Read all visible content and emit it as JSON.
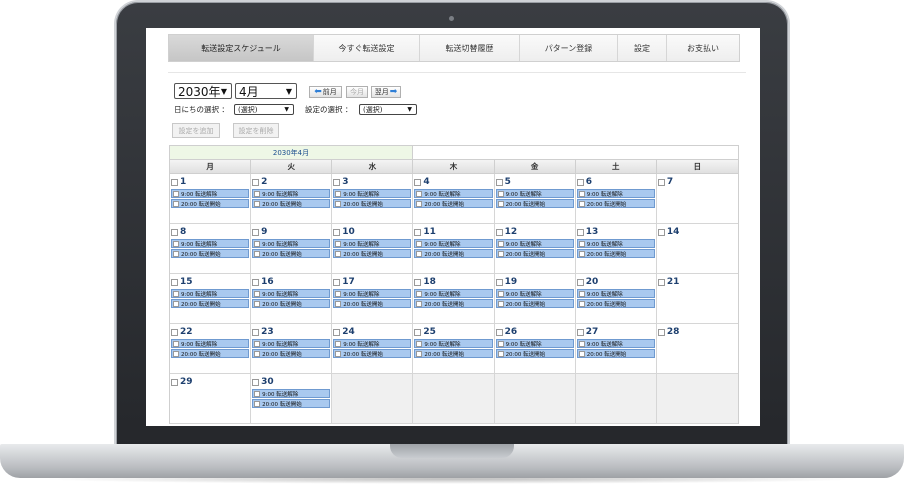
{
  "tabs": [
    {
      "label": "転送設定スケジュール",
      "active": true
    },
    {
      "label": "今すぐ転送設定",
      "active": false
    },
    {
      "label": "転送切替履歴",
      "active": false
    },
    {
      "label": "パターン登録",
      "active": false
    },
    {
      "label": "設定",
      "active": false
    },
    {
      "label": "お支払い",
      "active": false
    }
  ],
  "controls": {
    "year_value": "2030年",
    "month_value": "4月",
    "prev_label": "前月",
    "today_label": "今月",
    "next_label": "翌月",
    "day_select_label": "日にちの選択 ：",
    "day_select_value": "(選択)",
    "setting_select_label": "設定の選択 ：",
    "setting_select_value": "(選択)",
    "add_button": "設定を追加",
    "delete_button": "設定を削除"
  },
  "calendar": {
    "month_title": "2030年4月",
    "weekdays": [
      "月",
      "火",
      "水",
      "木",
      "金",
      "土",
      "日"
    ],
    "event_color": "#a9c9ef",
    "weeks": [
      [
        {
          "day": "1",
          "events": [
            "9:00 転送解除",
            "20:00 転送開始"
          ]
        },
        {
          "day": "2",
          "events": [
            "9:00 転送解除",
            "20:00 転送開始"
          ]
        },
        {
          "day": "3",
          "events": [
            "9:00 転送解除",
            "20:00 転送開始"
          ]
        },
        {
          "day": "4",
          "events": [
            "9:00 転送解除",
            "20:00 転送開始"
          ]
        },
        {
          "day": "5",
          "events": [
            "9:00 転送解除",
            "20:00 転送開始"
          ]
        },
        {
          "day": "6",
          "events": [
            "9:00 転送解除",
            "20:00 転送開始"
          ]
        },
        {
          "day": "7",
          "events": []
        }
      ],
      [
        {
          "day": "8",
          "events": [
            "9:00 転送解除",
            "20:00 転送開始"
          ]
        },
        {
          "day": "9",
          "events": [
            "9:00 転送解除",
            "20:00 転送開始"
          ]
        },
        {
          "day": "10",
          "events": [
            "9:00 転送解除",
            "20:00 転送開始"
          ]
        },
        {
          "day": "11",
          "events": [
            "9:00 転送解除",
            "20:00 転送開始"
          ]
        },
        {
          "day": "12",
          "events": [
            "9:00 転送解除",
            "20:00 転送開始"
          ]
        },
        {
          "day": "13",
          "events": [
            "9:00 転送解除",
            "20:00 転送開始"
          ]
        },
        {
          "day": "14",
          "events": []
        }
      ],
      [
        {
          "day": "15",
          "events": [
            "9:00 転送解除",
            "20:00 転送開始"
          ]
        },
        {
          "day": "16",
          "events": [
            "9:00 転送解除",
            "20:00 転送開始"
          ]
        },
        {
          "day": "17",
          "events": [
            "9:00 転送解除",
            "20:00 転送開始"
          ]
        },
        {
          "day": "18",
          "events": [
            "9:00 転送解除",
            "20:00 転送開始"
          ]
        },
        {
          "day": "19",
          "events": [
            "9:00 転送解除",
            "20:00 転送開始"
          ]
        },
        {
          "day": "20",
          "events": [
            "9:00 転送解除",
            "20:00 転送開始"
          ]
        },
        {
          "day": "21",
          "events": []
        }
      ],
      [
        {
          "day": "22",
          "events": [
            "9:00 転送解除",
            "20:00 転送開始"
          ]
        },
        {
          "day": "23",
          "events": [
            "9:00 転送解除",
            "20:00 転送開始"
          ]
        },
        {
          "day": "24",
          "events": [
            "9:00 転送解除",
            "20:00 転送開始"
          ]
        },
        {
          "day": "25",
          "events": [
            "9:00 転送解除",
            "20:00 転送開始"
          ]
        },
        {
          "day": "26",
          "events": [
            "9:00 転送解除",
            "20:00 転送開始"
          ]
        },
        {
          "day": "27",
          "events": [
            "9:00 転送解除",
            "20:00 転送開始"
          ]
        },
        {
          "day": "28",
          "events": []
        }
      ],
      [
        {
          "day": "29",
          "events": []
        },
        {
          "day": "30",
          "events": [
            "9:00 転送解除",
            "20:00 転送開始"
          ]
        },
        null,
        null,
        null,
        null,
        null
      ]
    ]
  }
}
